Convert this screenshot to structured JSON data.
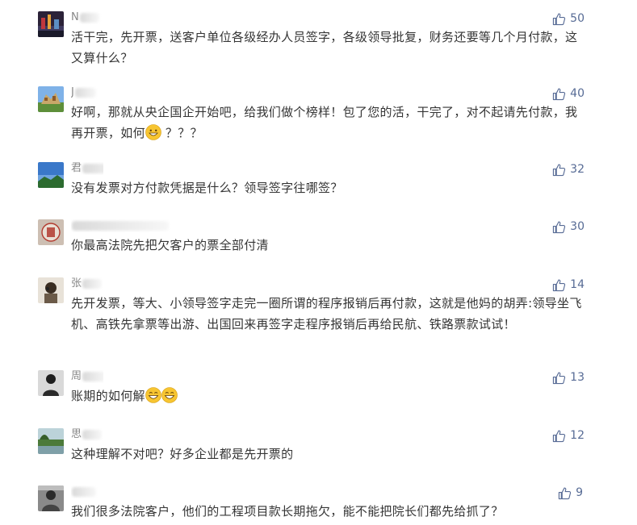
{
  "comments": [
    {
      "nick_initial": "N",
      "text": "活干完，先开票，送客户单位各级经办人员签字，各级领导批复，财务还要等几个月付款，这又算什么？",
      "likes": "50"
    },
    {
      "nick_initial": "J",
      "text_before": "好啊，那就从央企国企开始吧，给我们做个榜样！包了您的活，干完了，对不起请先付款，我再开票，如何",
      "emoji": "grinning-face-emoji",
      "text_after": "？？？",
      "likes": "40"
    },
    {
      "nick_initial": "君",
      "text": "没有发票对方付款凭据是什么？领导签字往哪签？",
      "likes": "32"
    },
    {
      "nick_initial": "",
      "text": "你最高法院先把欠客户的票全部付清",
      "likes": "30"
    },
    {
      "nick_initial": "张",
      "text": "先开发票，等大、小领导签字走完一圈所谓的程序报销后再付款，这就是他妈的胡弄:领导坐飞机、高铁先拿票等出游、出国回来再签字走程序报销后再给民航、铁路票款试试！",
      "likes": "14"
    },
    {
      "nick_initial": "周",
      "text": "账期的如何解",
      "emoji": "grinning-face-emoji",
      "likes": "13"
    },
    {
      "nick_initial": "思",
      "text": "这种理解不对吧？好多企业都是先开票的",
      "likes": "12"
    },
    {
      "nick_initial": "",
      "text": "我们很多法院客户，他们的工程项目款长期拖欠，能不能把院长们都先给抓了？",
      "likes": "9"
    }
  ]
}
